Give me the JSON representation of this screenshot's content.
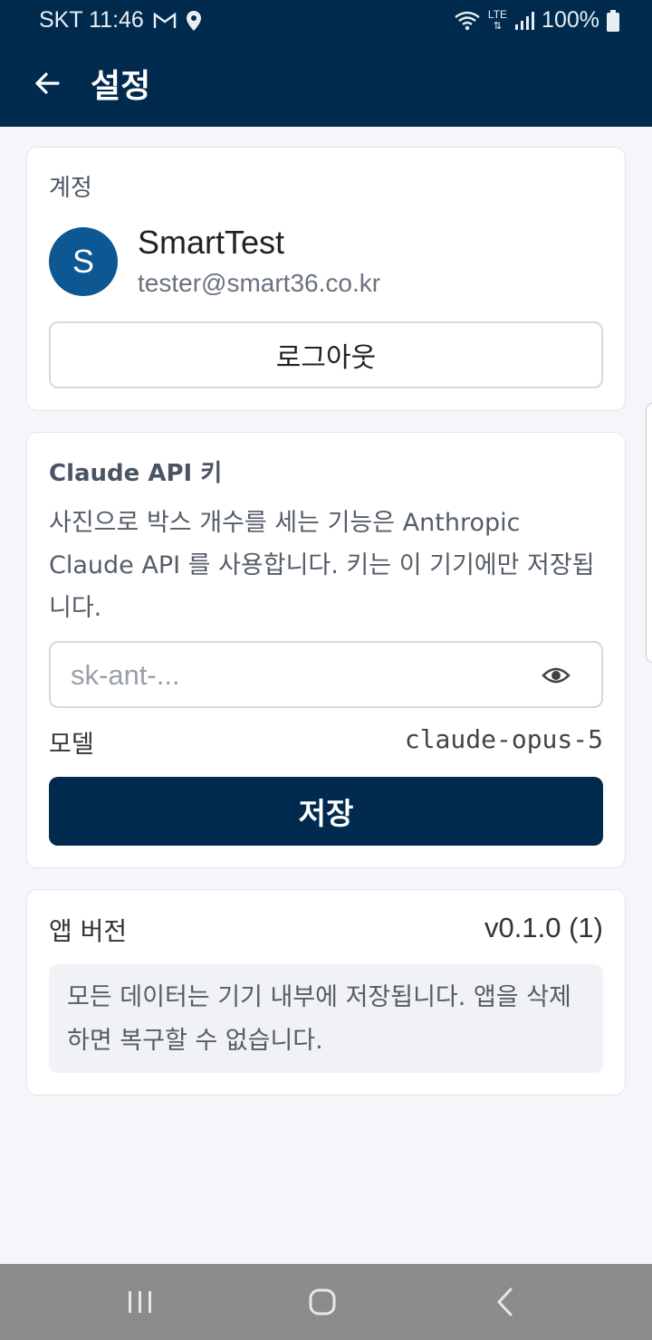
{
  "status_bar": {
    "carrier_time": "SKT 11:46",
    "lte_label": "LTE",
    "battery": "100%",
    "icons": [
      "gmail-icon",
      "location-icon",
      "wifi-icon",
      "lte-icon",
      "signal-icon",
      "battery-icon"
    ]
  },
  "app_bar": {
    "title": "설정",
    "back_icon": "arrow-left-icon"
  },
  "account": {
    "section_title": "계정",
    "avatar_letter": "S",
    "name": "SmartTest",
    "email": "tester@smart36.co.kr",
    "logout_label": "로그아웃"
  },
  "api": {
    "section_title": "Claude API 키",
    "description": "사진으로 박스 개수를 세는 기능은 Anthropic Claude API 를 사용합니다. 키는 이 기기에만 저장됩니다.",
    "key_placeholder": "sk-ant-...",
    "key_value": "",
    "visibility_icon": "eye-icon",
    "model_label": "모델",
    "model_value": "claude-opus-5",
    "save_label": "저장"
  },
  "about": {
    "version_label": "앱 버전",
    "version_value": "v0.1.0 (1)",
    "notice": "모든 데이터는 기기 내부에 저장됩니다. 앱을 삭제하면 복구할 수 없습니다."
  },
  "nav_bar": {
    "icons": [
      "recent-apps-icon",
      "home-icon",
      "back-icon"
    ]
  },
  "colors": {
    "primary": "#012b4e",
    "avatar": "#0d5792",
    "background": "#f5f6f9"
  }
}
